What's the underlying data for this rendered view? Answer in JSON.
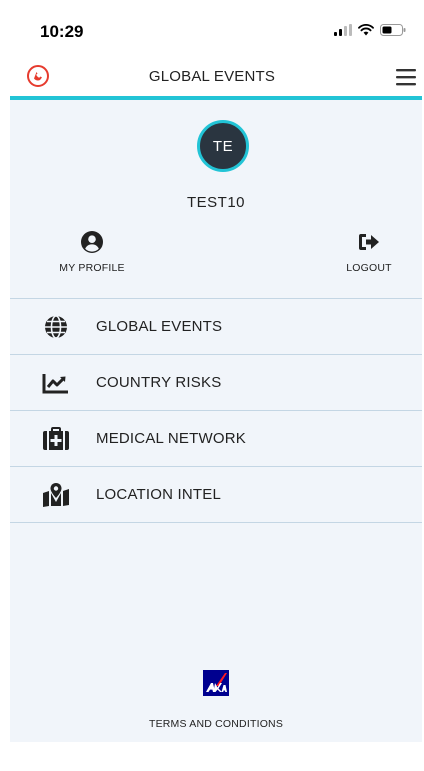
{
  "status_bar": {
    "time": "10:29",
    "icons": [
      "signal-icon",
      "wifi-icon",
      "battery-icon"
    ]
  },
  "header": {
    "title": "GLOBAL EVENTS",
    "left_icon": "phone-icon",
    "right_icon": "hamburger-menu-icon"
  },
  "user": {
    "initials": "TE",
    "name": "TEST10"
  },
  "quick_actions": [
    {
      "label": "MY PROFILE",
      "icon": "user-circle-icon"
    },
    {
      "label": "LOGOUT",
      "icon": "logout-icon"
    }
  ],
  "menu": [
    {
      "label": "GLOBAL EVENTS",
      "icon": "globe-icon"
    },
    {
      "label": "COUNTRY RISKS",
      "icon": "chart-line-icon"
    },
    {
      "label": "MEDICAL NETWORK",
      "icon": "medical-kit-icon"
    },
    {
      "label": "LOCATION INTEL",
      "icon": "map-pin-icon"
    }
  ],
  "footer": {
    "logo": "axa-logo",
    "terms_label": "TERMS AND CONDITIONS"
  },
  "colors": {
    "accent": "#22c4d6",
    "phone_icon": "#e63b2e",
    "drawer_bg": "#f1f5fa",
    "avatar_bg": "#2a3540",
    "brand_blue": "#00008f",
    "brand_red": "#ff1721"
  }
}
